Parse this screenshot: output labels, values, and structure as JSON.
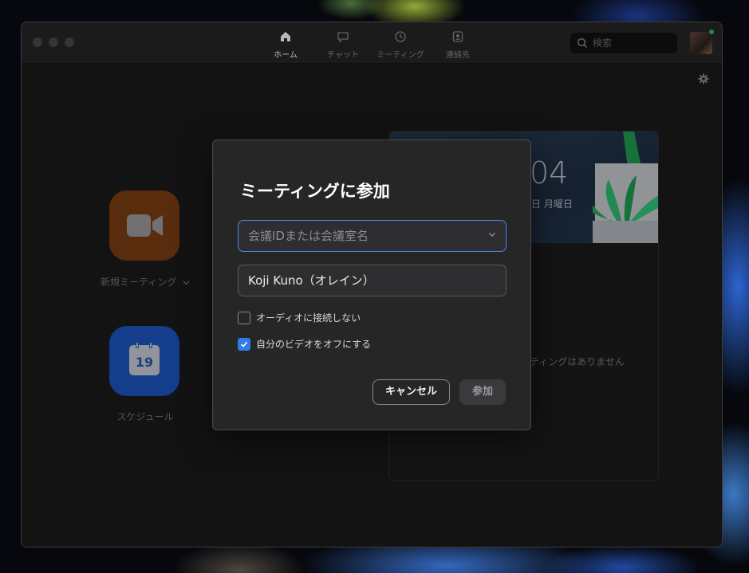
{
  "nav": {
    "tabs": [
      {
        "label": "ホーム",
        "icon": "home-icon",
        "active": true
      },
      {
        "label": "チャット",
        "icon": "chat-icon",
        "active": false
      },
      {
        "label": "ミーティング",
        "icon": "clock-icon",
        "active": false
      },
      {
        "label": "連絡先",
        "icon": "contacts-icon",
        "active": false
      }
    ]
  },
  "search": {
    "placeholder": "検索"
  },
  "home": {
    "new_meeting_label": "新規ミーティング",
    "schedule_label": "スケジュール",
    "calendar_day": "19",
    "clock_time": "04",
    "clock_date": "日 月曜日",
    "no_meetings_text": "ティングはありません"
  },
  "dialog": {
    "title": "ミーティングに参加",
    "meeting_id_placeholder": "会議IDまたは会議室名",
    "name_value": "Koji Kuno（オレイン）",
    "no_audio_label": "オーディオに接続しない",
    "no_audio_checked": false,
    "video_off_label": "自分のビデオをオフにする",
    "video_off_checked": true,
    "cancel_label": "キャンセル",
    "join_label": "参加"
  },
  "colors": {
    "accent": "#2d7de8",
    "new_meeting_tile": "#7a3e13",
    "schedule_tile": "#1d56c2",
    "presence": "#32c24d"
  }
}
